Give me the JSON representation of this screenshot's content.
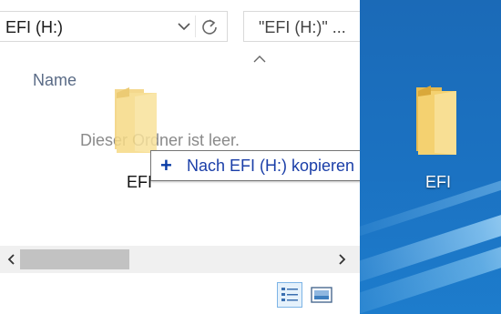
{
  "explorer": {
    "address": {
      "value": "EFI (H:)",
      "dropdown_icon": "chevron-down-icon",
      "refresh_icon": "refresh-icon"
    },
    "search": {
      "placeholder": "\"EFI (H:)\" ..."
    },
    "header": {
      "column_name": "Name",
      "sort_icon": "sort-ascending-icon"
    },
    "empty_message": "Dieser Ordner ist leer.",
    "drag": {
      "item_label": "EFI",
      "icon": "folder-icon"
    },
    "tooltip": {
      "symbol": "+",
      "text": "Nach EFI (H:) kopieren"
    },
    "scrollbar": {
      "left_icon": "chevron-left-icon",
      "right_icon": "chevron-right-icon"
    },
    "view_buttons": {
      "details_icon": "details-view-icon",
      "tiles_icon": "large-icons-view-icon"
    }
  },
  "desktop": {
    "item": {
      "label": "EFI",
      "icon": "folder-icon"
    }
  },
  "colors": {
    "tooltip_text": "#1a3ea8",
    "desktop_bg": "#1b6ab7",
    "folder_yellow": "#f6d36b"
  }
}
